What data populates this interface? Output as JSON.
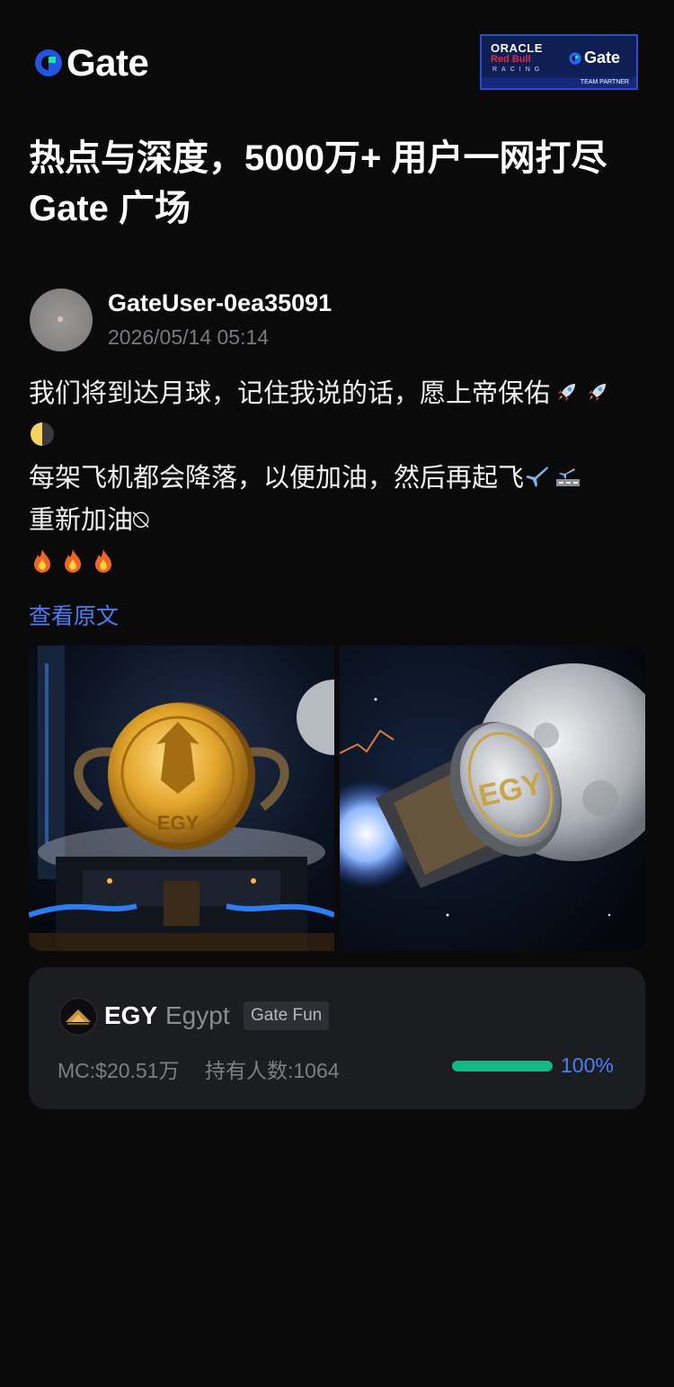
{
  "header": {
    "brand": "Gate",
    "partner": {
      "oracle": "ORACLE",
      "redbull": "Red Bull",
      "racing": "RACING",
      "gate": "Gate",
      "team": "TEAM PARTNER"
    }
  },
  "headline": {
    "line1": "热点与深度，5000万+ 用户一网打尽",
    "line2": "Gate 广场"
  },
  "post": {
    "username": "GateUser-0ea35091",
    "timestamp": "2026/05/14 05:14",
    "lines": [
      "我们将到达月球，记住我说的话，愿上帝保佑",
      "",
      "每架飞机都会降落，以便加油，然后再起飞",
      "重新加油⍉",
      ""
    ],
    "emoji": [
      "rocket-icon",
      "rocket-icon",
      "moon-icon",
      "airplane-icon",
      "runway-icon",
      "fire-icon",
      "fire-icon",
      "fire-icon"
    ],
    "translate_link": "查看原文"
  },
  "gallery": {
    "images": [
      "coin-on-launchpad-image",
      "coin-rocket-moon-image"
    ]
  },
  "token": {
    "symbol": "EGY",
    "name": "Egypt",
    "tag": "Gate Fun",
    "market_cap": "MC:$20.51万",
    "holders": "持有人数:1064",
    "progress": 1.0,
    "progress_label": "100%"
  },
  "colors": {
    "background": "#0a0a0b",
    "accent_blue": "#4a7ff7",
    "progress_green": "#12b886",
    "card_bg": "#1c1d21"
  }
}
